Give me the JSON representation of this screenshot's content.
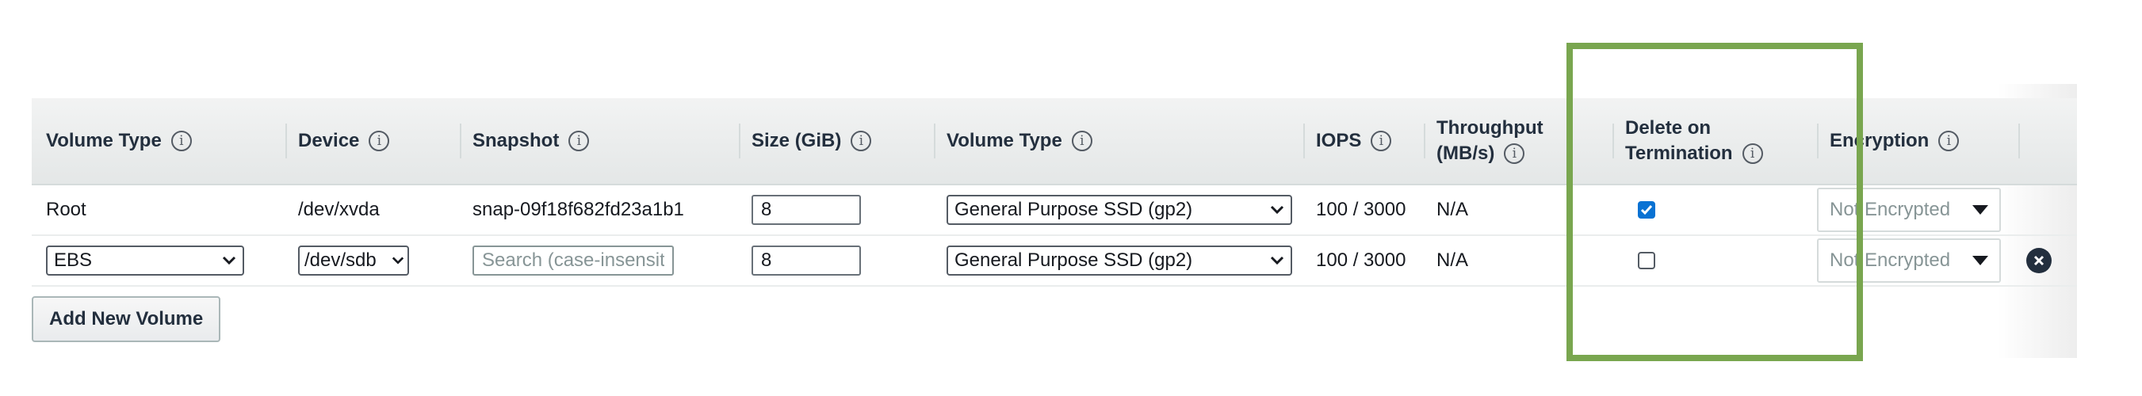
{
  "columns": {
    "volume_type": "Volume Type",
    "device": "Device",
    "snapshot": "Snapshot",
    "size": "Size (GiB)",
    "volume_type2": "Volume Type",
    "iops": "IOPS",
    "throughput_line1": "Throughput",
    "throughput_line2": "(MB/s)",
    "delete_line1": "Delete on",
    "delete_line2": "Termination",
    "encryption": "Encryption"
  },
  "info_glyph": "i",
  "rows": [
    {
      "volume_type": "Root",
      "device": "/dev/xvda",
      "snapshot": "snap-09f18f682fd23a1b1",
      "size": "8",
      "ebs_volume_type": "General Purpose SSD (gp2)",
      "iops": "100 / 3000",
      "throughput": "N/A",
      "delete_on_termination": true,
      "encryption": "Not Encrypted"
    },
    {
      "volume_type": "EBS",
      "device": "/dev/sdb",
      "snapshot_placeholder": "Search (case-insensit",
      "size": "8",
      "ebs_volume_type": "General Purpose SSD (gp2)",
      "iops": "100 / 3000",
      "throughput": "N/A",
      "delete_on_termination": false,
      "encryption": "Not Encrypted"
    }
  ],
  "add_button_label": "Add New Volume",
  "colors": {
    "highlight": "#79a64f",
    "checkbox_checked": "#0972d3",
    "header_bg": "#eaeded"
  },
  "icons": {
    "info": "info-icon",
    "remove": "close-circle-icon",
    "dropdown": "caret-down-icon",
    "check": "check-icon"
  }
}
